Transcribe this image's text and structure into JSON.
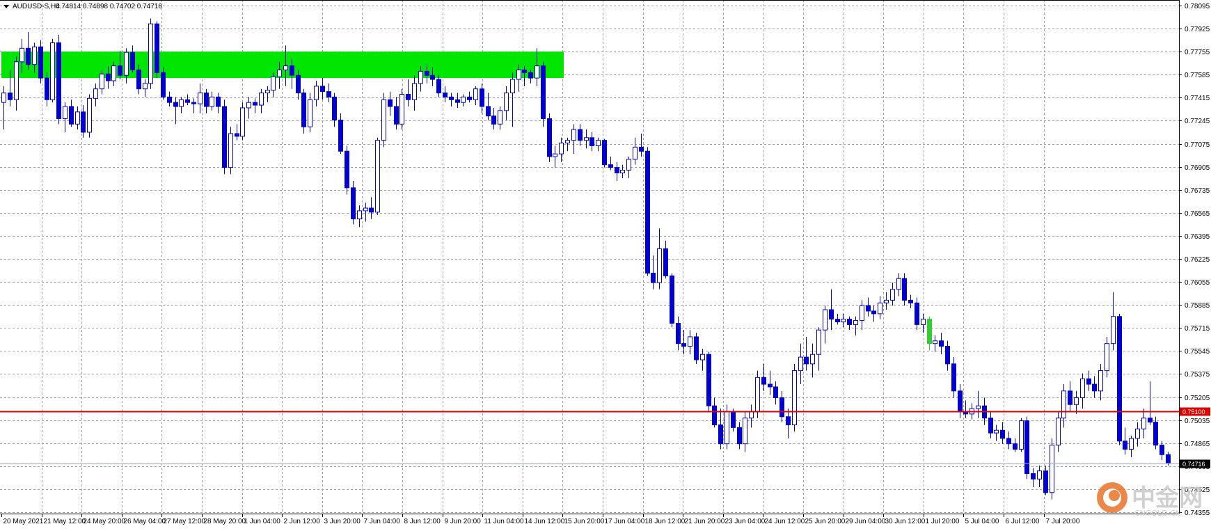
{
  "header": {
    "symbol": "AUDUSD-S,H4",
    "ohlc": "0.74814 0.74898 0.74702 0.74716",
    "menu_icon": "triangle-down-icon"
  },
  "watermark": {
    "text": "中金网",
    "sub": "CNGOLD.CN",
    "logo_icon": "cngold-logo-icon"
  },
  "colors": {
    "candle": "#0000d0",
    "candle_alt": "#33cc33",
    "zone": "#00e600",
    "support_line": "#e00000",
    "price_line": "#a0b0c0",
    "grid": "#9aa0a8"
  },
  "chart_data": {
    "type": "candlestick",
    "instrument": "AUDUSD-S",
    "timeframe": "H4",
    "y_ticks": [
      "0.78095",
      "0.77925",
      "0.77755",
      "0.77585",
      "0.77415",
      "0.77245",
      "0.77075",
      "0.76905",
      "0.76735",
      "0.76565",
      "0.76395",
      "0.76225",
      "0.76055",
      "0.75885",
      "0.75715",
      "0.75545",
      "0.75375",
      "0.75205",
      "0.75035",
      "0.74865",
      "0.74695",
      "0.74525",
      "0.74355"
    ],
    "ylim": [
      0.74355,
      0.78095
    ],
    "x_ticks": [
      "20 May 2021",
      "21 May 12:00",
      "24 May 20:00",
      "26 May 04:00",
      "27 May 12:00",
      "28 May 20:00",
      "1 Jun 04:00",
      "2 Jun 12:00",
      "3 Jun 20:00",
      "7 Jun 04:00",
      "8 Jun 12:00",
      "9 Jun 20:00",
      "11 Jun 04:00",
      "14 Jun 12:00",
      "15 Jun 20:00",
      "17 Jun 04:00",
      "18 Jun 12:00",
      "21 Jun 20:00",
      "23 Jun 04:00",
      "24 Jun 12:00",
      "25 Jun 20:00",
      "29 Jun 04:00",
      "30 Jun 12:00",
      "1 Jul 20:00",
      "5 Jul 04:00",
      "6 Jul 12:00",
      "7 Jul 20:00"
    ],
    "resistance_zone": {
      "from": 0.7756,
      "to": 0.77755
    },
    "support_level": {
      "value": 0.751,
      "label": "0.75100"
    },
    "current_price": {
      "value": 0.74716,
      "label": "0.74716"
    },
    "candles": [
      [
        0.7738,
        0.775,
        0.7718,
        0.7745
      ],
      [
        0.7745,
        0.7762,
        0.7735,
        0.774
      ],
      [
        0.774,
        0.7772,
        0.7732,
        0.7768
      ],
      [
        0.7768,
        0.7785,
        0.776,
        0.7778
      ],
      [
        0.7778,
        0.779,
        0.7762,
        0.7766
      ],
      [
        0.7766,
        0.7782,
        0.776,
        0.7779
      ],
      [
        0.7779,
        0.7784,
        0.7752,
        0.7756
      ],
      [
        0.7756,
        0.776,
        0.7735,
        0.774
      ],
      [
        0.774,
        0.7785,
        0.7738,
        0.7782
      ],
      [
        0.7782,
        0.7788,
        0.7722,
        0.7726
      ],
      [
        0.7726,
        0.7738,
        0.7716,
        0.7735
      ],
      [
        0.7735,
        0.774,
        0.772,
        0.7722
      ],
      [
        0.7722,
        0.7735,
        0.7718,
        0.7731
      ],
      [
        0.7731,
        0.7736,
        0.7712,
        0.7716
      ],
      [
        0.7716,
        0.7744,
        0.7712,
        0.7741
      ],
      [
        0.7741,
        0.7752,
        0.7735,
        0.7748
      ],
      [
        0.7748,
        0.7762,
        0.7744,
        0.7759
      ],
      [
        0.7759,
        0.7765,
        0.7748,
        0.7754
      ],
      [
        0.7754,
        0.7768,
        0.775,
        0.7765
      ],
      [
        0.7765,
        0.7776,
        0.7755,
        0.7758
      ],
      [
        0.7758,
        0.7778,
        0.7752,
        0.7775
      ],
      [
        0.7775,
        0.778,
        0.776,
        0.7762
      ],
      [
        0.7762,
        0.7766,
        0.7744,
        0.7748
      ],
      [
        0.7748,
        0.7755,
        0.7742,
        0.7752
      ],
      [
        0.7752,
        0.78,
        0.7748,
        0.7796
      ],
      [
        0.7796,
        0.7798,
        0.7756,
        0.776
      ],
      [
        0.776,
        0.7764,
        0.774,
        0.7742
      ],
      [
        0.7742,
        0.7746,
        0.7735,
        0.7738
      ],
      [
        0.7738,
        0.7742,
        0.7722,
        0.7735
      ],
      [
        0.7735,
        0.7742,
        0.773,
        0.774
      ],
      [
        0.774,
        0.7744,
        0.7736,
        0.7738
      ],
      [
        0.7738,
        0.7741,
        0.773,
        0.7737
      ],
      [
        0.7737,
        0.7752,
        0.773,
        0.7745
      ],
      [
        0.7745,
        0.7748,
        0.773,
        0.7735
      ],
      [
        0.7735,
        0.7746,
        0.7732,
        0.7742
      ],
      [
        0.7742,
        0.7745,
        0.773,
        0.7735
      ],
      [
        0.7735,
        0.774,
        0.7685,
        0.769
      ],
      [
        0.769,
        0.772,
        0.7685,
        0.7715
      ],
      [
        0.7715,
        0.7722,
        0.771,
        0.7713
      ],
      [
        0.7713,
        0.7738,
        0.771,
        0.7734
      ],
      [
        0.7734,
        0.7742,
        0.7726,
        0.7738
      ],
      [
        0.7738,
        0.7741,
        0.773,
        0.7736
      ],
      [
        0.7736,
        0.7748,
        0.773,
        0.7745
      ],
      [
        0.7745,
        0.775,
        0.7738,
        0.7747
      ],
      [
        0.7747,
        0.776,
        0.7742,
        0.7757
      ],
      [
        0.7757,
        0.7768,
        0.7748,
        0.7762
      ],
      [
        0.7762,
        0.778,
        0.775,
        0.7765
      ],
      [
        0.7765,
        0.777,
        0.7748,
        0.7758
      ],
      [
        0.7758,
        0.7762,
        0.774,
        0.7745
      ],
      [
        0.7745,
        0.7748,
        0.7715,
        0.772
      ],
      [
        0.772,
        0.7745,
        0.7716,
        0.774
      ],
      [
        0.774,
        0.7754,
        0.7735,
        0.775
      ],
      [
        0.775,
        0.7756,
        0.774,
        0.7746
      ],
      [
        0.7746,
        0.7752,
        0.7738,
        0.7742
      ],
      [
        0.7742,
        0.7745,
        0.772,
        0.7725
      ],
      [
        0.7725,
        0.773,
        0.77,
        0.7702
      ],
      [
        0.7702,
        0.7706,
        0.767,
        0.7675
      ],
      [
        0.7675,
        0.768,
        0.7648,
        0.7652
      ],
      [
        0.7652,
        0.7662,
        0.7646,
        0.7658
      ],
      [
        0.7658,
        0.7664,
        0.765,
        0.766
      ],
      [
        0.766,
        0.7668,
        0.7652,
        0.7657
      ],
      [
        0.7657,
        0.7712,
        0.7655,
        0.771
      ],
      [
        0.771,
        0.7745,
        0.7705,
        0.774
      ],
      [
        0.774,
        0.7746,
        0.7728,
        0.7735
      ],
      [
        0.7735,
        0.7742,
        0.7718,
        0.7722
      ],
      [
        0.7722,
        0.7748,
        0.7718,
        0.7744
      ],
      [
        0.7744,
        0.7755,
        0.7735,
        0.774
      ],
      [
        0.774,
        0.7758,
        0.7732,
        0.7752
      ],
      [
        0.7752,
        0.7765,
        0.7746,
        0.7761
      ],
      [
        0.7761,
        0.7766,
        0.7752,
        0.7758
      ],
      [
        0.7758,
        0.7764,
        0.775,
        0.7755
      ],
      [
        0.7755,
        0.7758,
        0.7742,
        0.7745
      ],
      [
        0.7745,
        0.775,
        0.7738,
        0.7742
      ],
      [
        0.7742,
        0.7745,
        0.7735,
        0.774
      ],
      [
        0.774,
        0.7745,
        0.7734,
        0.7738
      ],
      [
        0.7738,
        0.7744,
        0.7735,
        0.7742
      ],
      [
        0.7742,
        0.7746,
        0.7738,
        0.774
      ],
      [
        0.774,
        0.775,
        0.7736,
        0.7748
      ],
      [
        0.7748,
        0.7752,
        0.773,
        0.7735
      ],
      [
        0.7735,
        0.7745,
        0.7725,
        0.7728
      ],
      [
        0.7728,
        0.7734,
        0.7718,
        0.7722
      ],
      [
        0.7722,
        0.7735,
        0.7718,
        0.7732
      ],
      [
        0.7732,
        0.775,
        0.7725,
        0.7745
      ],
      [
        0.7745,
        0.776,
        0.772,
        0.7755
      ],
      [
        0.7755,
        0.7766,
        0.7746,
        0.7762
      ],
      [
        0.7762,
        0.7765,
        0.775,
        0.776
      ],
      [
        0.776,
        0.7762,
        0.7752,
        0.7756
      ],
      [
        0.7756,
        0.7778,
        0.775,
        0.7765
      ],
      [
        0.7765,
        0.7768,
        0.772,
        0.7726
      ],
      [
        0.7726,
        0.773,
        0.7694,
        0.7698
      ],
      [
        0.7698,
        0.7706,
        0.769,
        0.77
      ],
      [
        0.77,
        0.7712,
        0.7694,
        0.7708
      ],
      [
        0.7708,
        0.7712,
        0.7702,
        0.771
      ],
      [
        0.771,
        0.7722,
        0.77,
        0.7718
      ],
      [
        0.7718,
        0.7722,
        0.7706,
        0.771
      ],
      [
        0.771,
        0.7718,
        0.7704,
        0.7712
      ],
      [
        0.7712,
        0.7716,
        0.7702,
        0.7706
      ],
      [
        0.7706,
        0.7712,
        0.7702,
        0.771
      ],
      [
        0.771,
        0.7711,
        0.769,
        0.7692
      ],
      [
        0.7692,
        0.7698,
        0.7688,
        0.769
      ],
      [
        0.769,
        0.7694,
        0.768,
        0.7686
      ],
      [
        0.7686,
        0.7692,
        0.7682,
        0.7688
      ],
      [
        0.7688,
        0.7698,
        0.7682,
        0.7696
      ],
      [
        0.7696,
        0.7712,
        0.7692,
        0.7705
      ],
      [
        0.7705,
        0.7715,
        0.7698,
        0.7702
      ],
      [
        0.7702,
        0.7705,
        0.761,
        0.7612
      ],
      [
        0.7612,
        0.7625,
        0.76,
        0.7605
      ],
      [
        0.7605,
        0.7645,
        0.76,
        0.763
      ],
      [
        0.763,
        0.7636,
        0.7608,
        0.761
      ],
      [
        0.761,
        0.7612,
        0.7572,
        0.7575
      ],
      [
        0.7575,
        0.758,
        0.7555,
        0.756
      ],
      [
        0.756,
        0.757,
        0.7552,
        0.7558
      ],
      [
        0.7558,
        0.757,
        0.7552,
        0.7565
      ],
      [
        0.7565,
        0.7568,
        0.7545,
        0.7548
      ],
      [
        0.7548,
        0.7556,
        0.754,
        0.7552
      ],
      [
        0.7552,
        0.7554,
        0.751,
        0.7514
      ],
      [
        0.7514,
        0.752,
        0.7498,
        0.75
      ],
      [
        0.75,
        0.7512,
        0.7482,
        0.7486
      ],
      [
        0.7486,
        0.7515,
        0.7482,
        0.751
      ],
      [
        0.751,
        0.7512,
        0.7495,
        0.7498
      ],
      [
        0.7498,
        0.7502,
        0.7482,
        0.7486
      ],
      [
        0.7486,
        0.751,
        0.748,
        0.7505
      ],
      [
        0.7505,
        0.7515,
        0.7498,
        0.751
      ],
      [
        0.751,
        0.754,
        0.7505,
        0.7535
      ],
      [
        0.7535,
        0.7545,
        0.7525,
        0.753
      ],
      [
        0.753,
        0.754,
        0.7522,
        0.7528
      ],
      [
        0.7528,
        0.7532,
        0.7515,
        0.752
      ],
      [
        0.752,
        0.7525,
        0.7502,
        0.7506
      ],
      [
        0.7506,
        0.7512,
        0.749,
        0.75
      ],
      [
        0.75,
        0.7545,
        0.7495,
        0.754
      ],
      [
        0.754,
        0.756,
        0.753,
        0.755
      ],
      [
        0.755,
        0.7565,
        0.754,
        0.7545
      ],
      [
        0.7545,
        0.756,
        0.7535,
        0.7552
      ],
      [
        0.7552,
        0.7572,
        0.754,
        0.757
      ],
      [
        0.757,
        0.7588,
        0.756,
        0.7585
      ],
      [
        0.7585,
        0.76,
        0.757,
        0.7578
      ],
      [
        0.7578,
        0.7582,
        0.7574,
        0.7576
      ],
      [
        0.7576,
        0.7582,
        0.7572,
        0.7578
      ],
      [
        0.7578,
        0.758,
        0.757,
        0.7574
      ],
      [
        0.7574,
        0.758,
        0.7566,
        0.7577
      ],
      [
        0.7577,
        0.7592,
        0.757,
        0.7588
      ],
      [
        0.7588,
        0.7594,
        0.758,
        0.7584
      ],
      [
        0.7584,
        0.7588,
        0.7576,
        0.7582
      ],
      [
        0.7582,
        0.7595,
        0.7578,
        0.759
      ],
      [
        0.759,
        0.7598,
        0.7585,
        0.7592
      ],
      [
        0.7592,
        0.7605,
        0.7588,
        0.76
      ],
      [
        0.76,
        0.7612,
        0.7595,
        0.7608
      ],
      [
        0.7608,
        0.7612,
        0.7588,
        0.7592
      ],
      [
        0.7592,
        0.7596,
        0.7586,
        0.759
      ],
      [
        0.759,
        0.7594,
        0.757,
        0.7574
      ],
      [
        0.7574,
        0.7582,
        0.7568,
        0.7578
      ],
      [
        0.7578,
        0.758,
        0.7555,
        0.756
      ],
      [
        0.756,
        0.7566,
        0.7554,
        0.7562
      ],
      [
        0.7562,
        0.7568,
        0.7552,
        0.7558
      ],
      [
        0.7558,
        0.7562,
        0.754,
        0.7545
      ],
      [
        0.7545,
        0.755,
        0.752,
        0.7525
      ],
      [
        0.7525,
        0.753,
        0.7505,
        0.751
      ],
      [
        0.751,
        0.7518,
        0.7505,
        0.7508
      ],
      [
        0.7508,
        0.7516,
        0.7504,
        0.7512
      ],
      [
        0.7512,
        0.7525,
        0.7505,
        0.7514
      ],
      [
        0.7514,
        0.752,
        0.75,
        0.7505
      ],
      [
        0.7505,
        0.751,
        0.749,
        0.7494
      ],
      [
        0.7494,
        0.75,
        0.7488,
        0.7496
      ],
      [
        0.7496,
        0.7502,
        0.7486,
        0.749
      ],
      [
        0.749,
        0.7495,
        0.7482,
        0.7486
      ],
      [
        0.7486,
        0.749,
        0.748,
        0.7482
      ],
      [
        0.7482,
        0.7505,
        0.748,
        0.7503
      ],
      [
        0.7503,
        0.7506,
        0.746,
        0.7464
      ],
      [
        0.7464,
        0.7468,
        0.7454,
        0.746
      ],
      [
        0.746,
        0.747,
        0.7454,
        0.7466
      ],
      [
        0.7466,
        0.747,
        0.7448,
        0.745
      ],
      [
        0.745,
        0.749,
        0.7445,
        0.7485
      ],
      [
        0.7485,
        0.751,
        0.748,
        0.7505
      ],
      [
        0.7505,
        0.753,
        0.7498,
        0.7525
      ],
      [
        0.7525,
        0.7532,
        0.751,
        0.7515
      ],
      [
        0.7515,
        0.7525,
        0.7508,
        0.752
      ],
      [
        0.752,
        0.7538,
        0.7512,
        0.7534
      ],
      [
        0.7534,
        0.754,
        0.7525,
        0.753
      ],
      [
        0.753,
        0.7536,
        0.752,
        0.7525
      ],
      [
        0.7525,
        0.7545,
        0.7518,
        0.754
      ],
      [
        0.754,
        0.7565,
        0.7535,
        0.756
      ],
      [
        0.756,
        0.7598,
        0.7555,
        0.758
      ],
      [
        0.758,
        0.7582,
        0.7485,
        0.7488
      ],
      [
        0.7488,
        0.7498,
        0.7478,
        0.7482
      ],
      [
        0.7482,
        0.7492,
        0.7476,
        0.749
      ],
      [
        0.749,
        0.7502,
        0.7484,
        0.7497
      ],
      [
        0.7497,
        0.7512,
        0.749,
        0.7505
      ],
      [
        0.7505,
        0.7532,
        0.75,
        0.7502
      ],
      [
        0.7502,
        0.7506,
        0.7482,
        0.7485
      ],
      [
        0.7485,
        0.7488,
        0.7474,
        0.7478
      ],
      [
        0.7478,
        0.748,
        0.747,
        0.7472
      ]
    ]
  }
}
